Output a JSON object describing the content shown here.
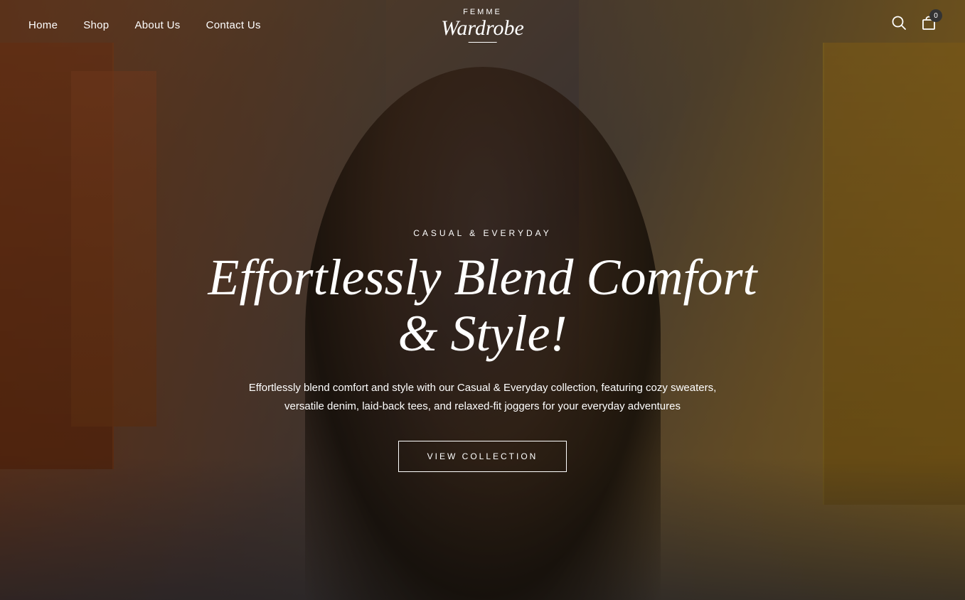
{
  "brand": {
    "name_top": "FEMME",
    "name_bottom": "Wardrobe"
  },
  "nav": {
    "links": [
      {
        "label": "Home",
        "id": "home"
      },
      {
        "label": "Shop",
        "id": "shop"
      },
      {
        "label": "About Us",
        "id": "about"
      },
      {
        "label": "Contact Us",
        "id": "contact"
      }
    ],
    "cart_count": "0"
  },
  "hero": {
    "eyebrow": "CASUAL & EVERYDAY",
    "headline": "Effortlessly Blend Comfort & Style!",
    "description": "Effortlessly blend comfort and style with our Casual & Everyday collection, featuring cozy sweaters, versatile denim, laid-back tees, and relaxed-fit joggers for your everyday adventures",
    "cta_label": "VIEW COLLECTION"
  }
}
